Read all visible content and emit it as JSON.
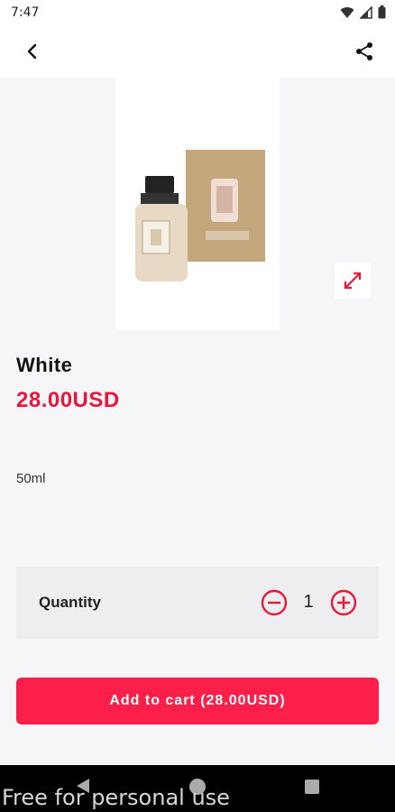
{
  "status": {
    "time": "7:47"
  },
  "icons": {
    "back": "back-arrow-icon",
    "share": "share-icon",
    "expand": "expand-icon",
    "minus": "minus-circle-icon",
    "plus": "plus-circle-icon"
  },
  "product": {
    "name": "White",
    "price": "28.00USD",
    "description": "50ml"
  },
  "quantity": {
    "label": "Quantity",
    "value": "1"
  },
  "cart": {
    "button_label": "Add to cart (28.00USD)"
  },
  "watermark": {
    "text": "Free for personal use"
  },
  "colors": {
    "accent": "#fc1f4a",
    "price": "#e8163a",
    "panel": "#eeeef1"
  }
}
